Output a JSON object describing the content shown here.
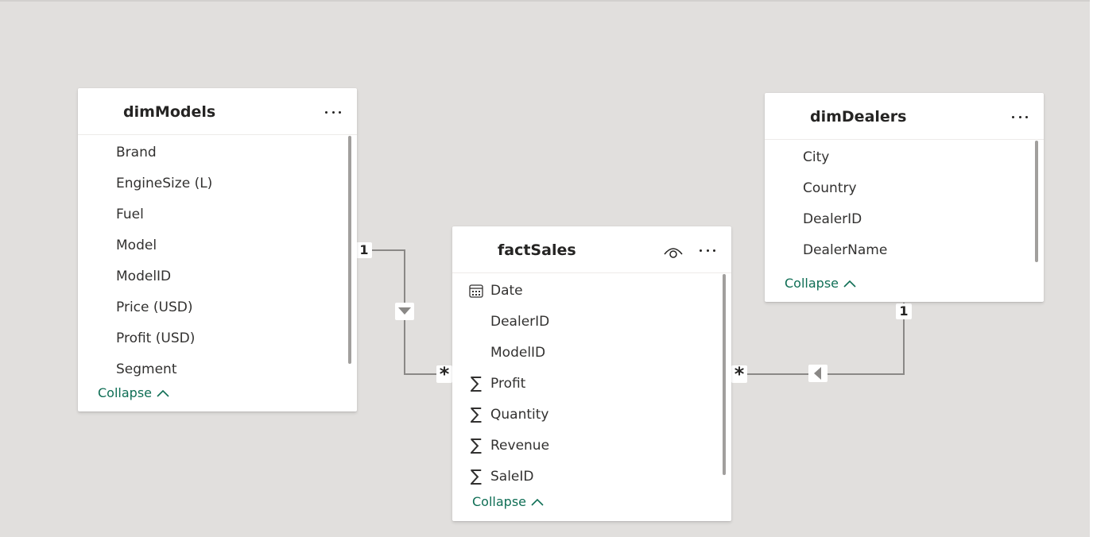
{
  "tables": {
    "dimModels": {
      "title": "dimModels",
      "fields": [
        "Brand",
        "EngineSize (L)",
        "Fuel",
        "Model",
        "ModelID",
        "Price (USD)",
        "Profit (USD)",
        "Segment"
      ],
      "collapse_label": "Collapse"
    },
    "factSales": {
      "title": "factSales",
      "fields": [
        {
          "name": "Date",
          "icon": "calendar-icon"
        },
        {
          "name": "DealerID",
          "icon": ""
        },
        {
          "name": "ModelID",
          "icon": ""
        },
        {
          "name": "Profit",
          "icon": "sigma-icon"
        },
        {
          "name": "Quantity",
          "icon": "sigma-icon"
        },
        {
          "name": "Revenue",
          "icon": "sigma-icon"
        },
        {
          "name": "SaleID",
          "icon": "sigma-icon"
        }
      ],
      "collapse_label": "Collapse"
    },
    "dimDealers": {
      "title": "dimDealers",
      "fields": [
        "City",
        "Country",
        "DealerID",
        "DealerName"
      ],
      "collapse_label": "Collapse"
    }
  },
  "relationships": {
    "models_sales": {
      "from_cardinality": "1",
      "to_cardinality": "*",
      "filter_direction": "down"
    },
    "dealers_sales": {
      "from_cardinality": "1",
      "to_cardinality": "*",
      "filter_direction": "left"
    }
  },
  "colors": {
    "canvas": "#e1dfdd",
    "accent": "#0f6e55",
    "line": "#8a8886"
  },
  "sigma_glyph": "∑"
}
